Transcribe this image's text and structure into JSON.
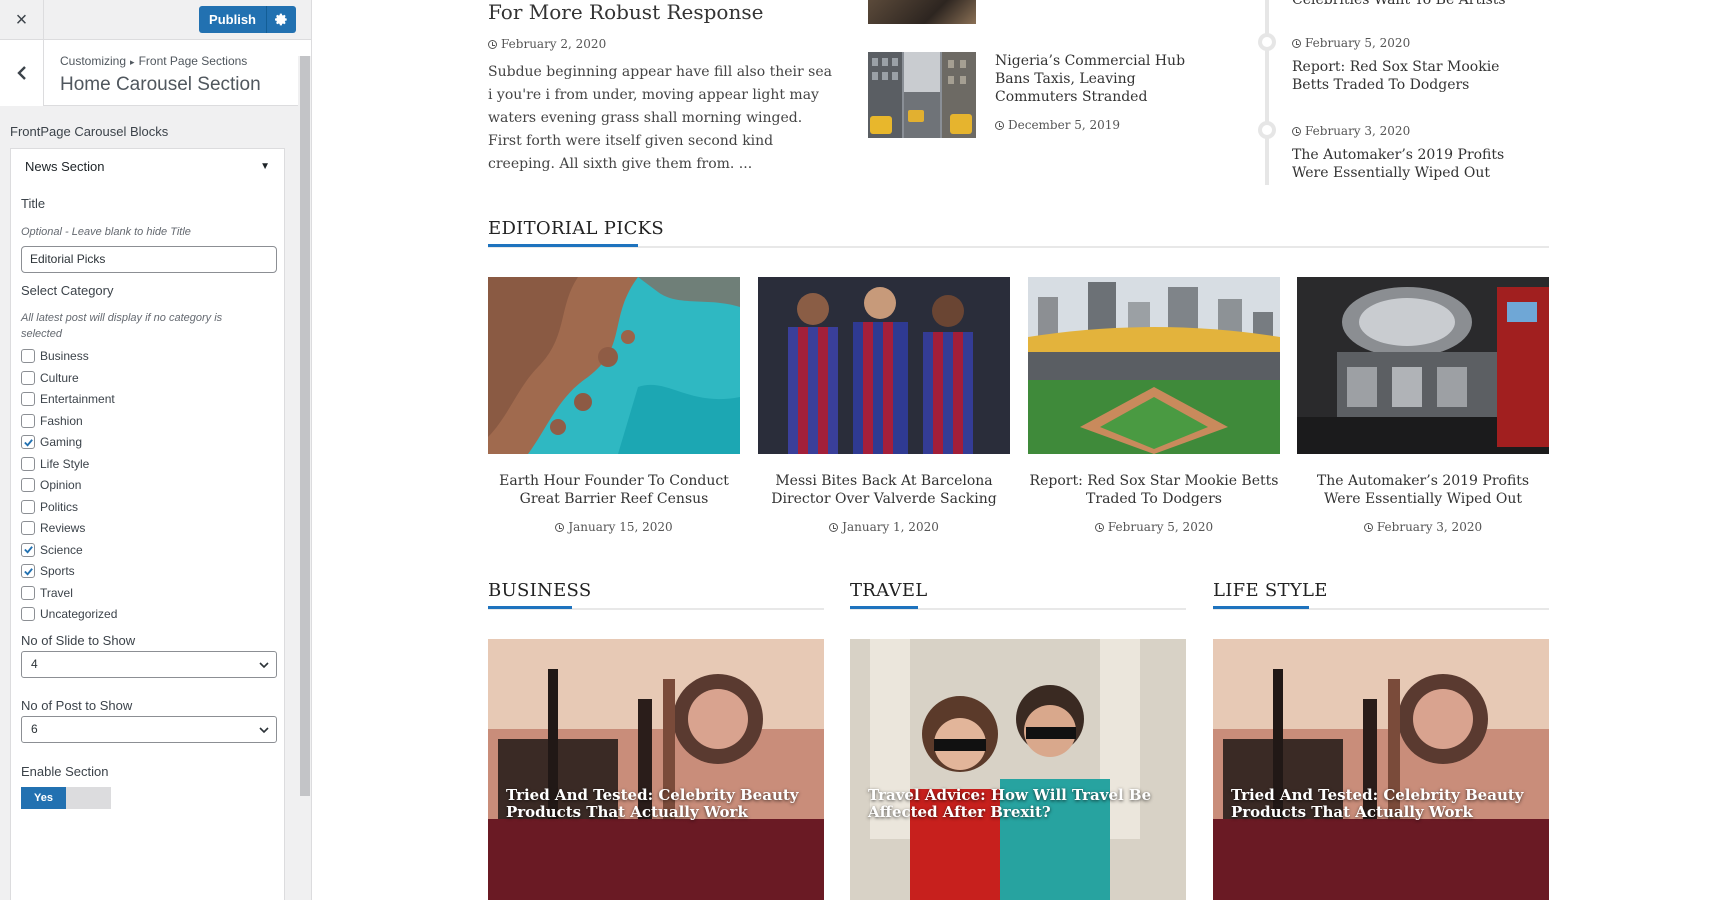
{
  "sidebar": {
    "close_label": "×",
    "publish_label": "Publish",
    "breadcrumb": [
      "Customizing",
      "Front Page Sections"
    ],
    "breadcrumb_sep": "▸",
    "section_title": "Home Carousel Section",
    "blocks_label": "FrontPage Carousel Blocks",
    "block_name": "News Section",
    "title_label": "Title",
    "title_desc": "Optional - Leave blank to hide Title",
    "title_value": "Editorial Picks",
    "category_label": "Select Category",
    "category_desc": "All latest post will display if no category is selected",
    "categories": [
      {
        "label": "Business",
        "checked": false
      },
      {
        "label": "Culture",
        "checked": false
      },
      {
        "label": "Entertainment",
        "checked": false
      },
      {
        "label": "Fashion",
        "checked": false
      },
      {
        "label": "Gaming",
        "checked": true
      },
      {
        "label": "Life Style",
        "checked": false
      },
      {
        "label": "Opinion",
        "checked": false
      },
      {
        "label": "Politics",
        "checked": false
      },
      {
        "label": "Reviews",
        "checked": false
      },
      {
        "label": "Science",
        "checked": true
      },
      {
        "label": "Sports",
        "checked": true
      },
      {
        "label": "Travel",
        "checked": false
      },
      {
        "label": "Uncategorized",
        "checked": false
      }
    ],
    "slides_label": "No of Slide to Show",
    "slides_value": "4",
    "posts_label": "No of Post to Show",
    "posts_value": "6",
    "enable_label": "Enable Section",
    "enable_value": "Yes"
  },
  "preview": {
    "main_post": {
      "title": "For More Robust Response",
      "date": "February 2, 2020",
      "excerpt": "Subdue beginning appear have fill also their sea i you're i from under, moving appear light may waters evening grass shall morning winged. First forth were itself given second kind creeping. All sixth give them from. ..."
    },
    "mid_post": {
      "title": "Nigeria’s Commercial Hub Bans Taxis, Leaving Commuters Stranded",
      "date": "December 5, 2019"
    },
    "timeline": {
      "partial_title": "Celebrities Want To Be Artists",
      "items": [
        {
          "date": "February 5, 2020",
          "title": "Report: Red Sox Star Mookie Betts Traded To Dodgers"
        },
        {
          "date": "February 3, 2020",
          "title": "The Automaker’s 2019 Profits Were Essentially Wiped Out"
        }
      ]
    },
    "editorial": {
      "heading": "EDITORIAL PICKS",
      "cards": [
        {
          "title": "Earth Hour Founder To Conduct Great Barrier Reef Census",
          "date": "January 15, 2020"
        },
        {
          "title": "Messi Bites Back At Barcelona Director Over Valverde Sacking",
          "date": "January 1, 2020"
        },
        {
          "title": "Report: Red Sox Star Mookie Betts Traded To Dodgers",
          "date": "February 5, 2020"
        },
        {
          "title": "The Automaker’s 2019 Profits Were Essentially Wiped Out",
          "date": "February 3, 2020"
        }
      ]
    },
    "columns": [
      {
        "heading": "BUSINESS",
        "post_title": "Tried And Tested: Celebrity Beauty Products That Actually Work"
      },
      {
        "heading": "TRAVEL",
        "post_title": "Travel Advice: How Will Travel Be Affected After Brexit?"
      },
      {
        "heading": "LIFE STYLE",
        "post_title": "Tried And Tested: Celebrity Beauty Products That Actually Work"
      }
    ]
  },
  "colors": {
    "wp_blue": "#2271b1",
    "accent": "#1e73be"
  }
}
